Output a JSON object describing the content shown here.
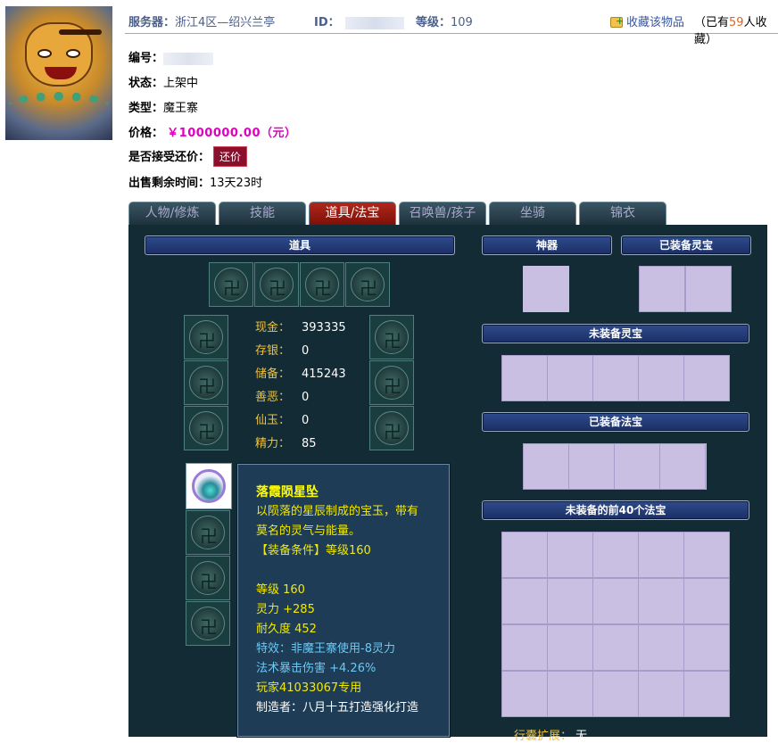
{
  "header": {
    "server_label": "服务器：",
    "server_value": "浙江4区—绍兴兰亭",
    "id_label": "ID：",
    "level_label": "等级：",
    "level_value": "109",
    "favorite_label": "收藏该物品",
    "fav_prefix": "（已有",
    "fav_count": "59",
    "fav_suffix": "人收藏）"
  },
  "info": {
    "number_label": "编号：",
    "status_label": "状态：",
    "status_value": "上架中",
    "type_label": "类型：",
    "type_value": "魔王寨",
    "price_label": "价格：",
    "price_value": "￥1000000.00（元）",
    "bargain_label": "是否接受还价：",
    "bargain_button": "还价",
    "time_label": "出售剩余时间：",
    "time_value": "13天23时"
  },
  "tabs": [
    {
      "label": "人物/修炼",
      "active": false
    },
    {
      "label": "技能",
      "active": false
    },
    {
      "label": "道具/法宝",
      "active": true
    },
    {
      "label": "召唤兽/孩子",
      "active": false
    },
    {
      "label": "坐骑",
      "active": false
    },
    {
      "label": "锦衣",
      "active": false
    }
  ],
  "panel": {
    "items_header": "道具",
    "artifact_header": "神器",
    "equipped_lingbao_header": "已装备灵宝",
    "unequipped_lingbao_header": "未装备灵宝",
    "equipped_fabao_header": "已装备法宝",
    "unequipped_fabao_header": "未装备的前40个法宝",
    "money": [
      {
        "label": "现金：",
        "value": "393335"
      },
      {
        "label": "存银：",
        "value": "0"
      },
      {
        "label": "储备：",
        "value": "415243"
      },
      {
        "label": "善恶：",
        "value": "0"
      },
      {
        "label": "仙玉：",
        "value": "0"
      },
      {
        "label": "精力：",
        "value": "85"
      }
    ],
    "bag_expand_label": "行囊扩展：",
    "bag_expand_value": "无"
  },
  "tooltip": {
    "title": "落霞陨星坠",
    "desc1": "以陨落的星辰制成的宝玉，带有",
    "desc2": "莫名的灵气与能量。",
    "requirement": "【装备条件】等级160",
    "level": "等级 160",
    "spirit": "灵力 +285",
    "durability": "耐久度 452",
    "special": "特效：非魔王寨使用-8灵力",
    "crit": "法术暴击伤害 +4.26%",
    "owner": "玩家41033067专用",
    "maker": "制造者：八月十五打造强化打造"
  }
}
